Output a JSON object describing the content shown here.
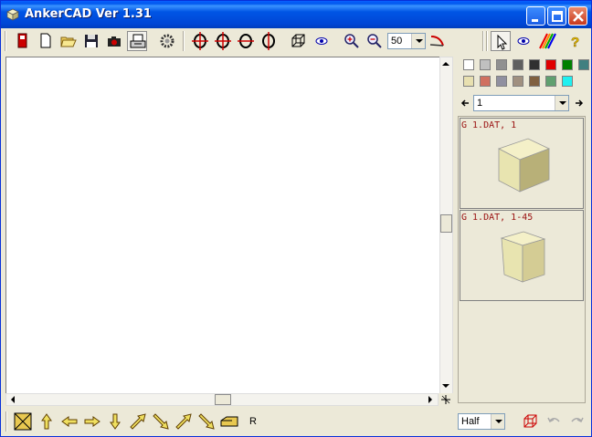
{
  "window": {
    "title": "AnkerCAD Ver 1.31"
  },
  "toolbar": {
    "zoom_value": "50"
  },
  "palette": {
    "colors": [
      "#ffffff",
      "#c0c0c0",
      "#909090",
      "#606060",
      "#303030",
      "#e00000",
      "#008000",
      "#408080",
      "#e8e0b0",
      "#d07060",
      "#9090a0",
      "#a09080",
      "#806040",
      "#60a070",
      "#20f0f0"
    ]
  },
  "step_nav": {
    "current": "1"
  },
  "steps": [
    {
      "label": "G 1.DAT, 1"
    },
    {
      "label": "G 1.DAT, 1-45"
    }
  ],
  "bottom": {
    "view_mode": "Half",
    "r_label": "R"
  },
  "colors": {
    "brick_face": "#e8e4b0",
    "brick_side": "#b8b078",
    "brick_top": "#f4f0c8"
  }
}
